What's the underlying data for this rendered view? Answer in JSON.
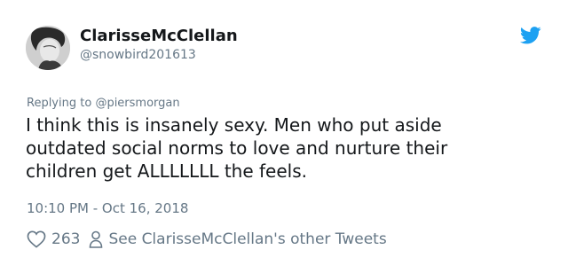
{
  "author": {
    "display_name": "ClarisseMcClellan",
    "handle": "@snowbird201613",
    "avatar": "user-avatar-photo"
  },
  "reply": {
    "prefix": "Replying to ",
    "mention": "@piersmorgan"
  },
  "tweet": {
    "lines": [
      "I think this is insanely sexy. Men who put aside",
      "outdated social norms to love and nurture their",
      "children get ALLLLLLL the feels."
    ],
    "timestamp": "10:10 PM - Oct 16, 2018"
  },
  "actions": {
    "like_count": "263",
    "profile_link": "See ClarisseMcClellan's other Tweets"
  },
  "icons": {
    "brand": "twitter-bird-icon",
    "like": "heart-icon",
    "profile": "person-icon"
  },
  "colors": {
    "twitter_blue": "#1da1f2",
    "text": "#14171a",
    "secondary": "#657786"
  }
}
